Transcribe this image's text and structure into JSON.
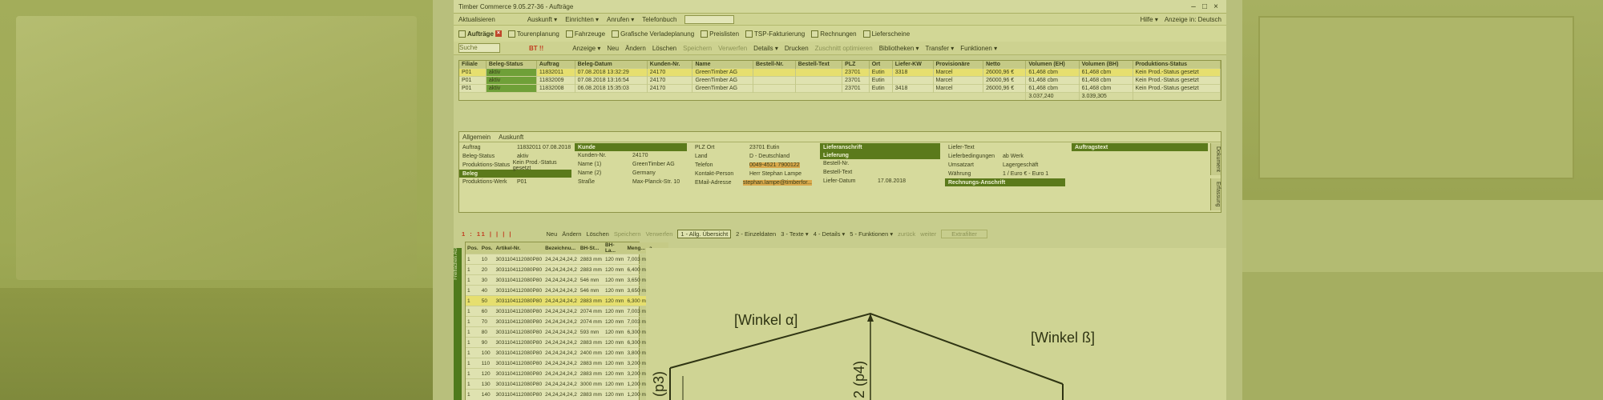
{
  "window": {
    "title": "Timber Commerce 9.05.27-36 - Aufträge",
    "close_label": "×",
    "max_label": "□",
    "min_label": "–"
  },
  "menubar": {
    "items": [
      "Aktualisieren",
      "Auskunft ▾",
      "Einrichten ▾",
      "Anrufen ▾",
      "Telefonbuch"
    ],
    "help": "Hilfe ▾",
    "display_lang": "Anzeige in: Deutsch"
  },
  "tabs": [
    {
      "label": "Aufträge",
      "active": true
    },
    {
      "label": "Tourenplanung"
    },
    {
      "label": "Fahrzeuge"
    },
    {
      "label": "Grafische Verladeplanung"
    },
    {
      "label": "Preislisten"
    },
    {
      "label": "TSP-Fakturierung"
    },
    {
      "label": "Rechnungen"
    },
    {
      "label": "Lieferscheine"
    }
  ],
  "toolbar": {
    "search_placeholder": "Suche",
    "bt": "BT !!",
    "items": [
      {
        "label": "Anzeige ▾",
        "dim": false
      },
      {
        "label": "Neu",
        "dim": false
      },
      {
        "label": "Ändern",
        "dim": false
      },
      {
        "label": "Löschen",
        "dim": false
      },
      {
        "label": "Speichern",
        "dim": true
      },
      {
        "label": "Verwerfen",
        "dim": true
      },
      {
        "label": "Details ▾",
        "dim": false
      },
      {
        "label": "Drucken",
        "dim": false
      },
      {
        "label": "Zuschnitt optimieren",
        "dim": true
      },
      {
        "label": "Bibliotheken ▾",
        "dim": false
      },
      {
        "label": "Transfer ▾",
        "dim": false
      },
      {
        "label": "Funktionen ▾",
        "dim": false
      }
    ]
  },
  "orders": {
    "columns": [
      "Filiale",
      "Beleg-Status",
      "Auftrag",
      "Beleg-Datum",
      "Kunden-Nr.",
      "Name",
      "Bestell-Nr.",
      "Bestell-Text",
      "PLZ",
      "Ort",
      "Liefer-KW",
      "Provisionäre",
      "Netto",
      "Volumen (EH)",
      "Volumen (BH)",
      "Produktions-Status"
    ],
    "rows": [
      [
        "P01",
        "aktiv",
        "11832011",
        "07.08.2018 13:32:29",
        "24170",
        "GreenTimber AG",
        "",
        "",
        "23701",
        "Eutin",
        "3318",
        "Marcel",
        "26000,96 €",
        "61,468 cbm",
        "61,468 cbm",
        "Kein Prod.-Status gesetzt"
      ],
      [
        "P01",
        "aktiv",
        "11832009",
        "07.08.2018 13:16:54",
        "24170",
        "GreenTimber AG",
        "",
        "",
        "23701",
        "Eutin",
        "",
        "Marcel",
        "26000,96 €",
        "61,468 cbm",
        "61,468 cbm",
        "Kein Prod.-Status gesetzt"
      ],
      [
        "P01",
        "aktiv",
        "11832008",
        "06.08.2018 15:35:03",
        "24170",
        "GreenTimber AG",
        "",
        "",
        "23701",
        "Eutin",
        "3418",
        "Marcel",
        "26000,96 €",
        "61,468 cbm",
        "61,468 cbm",
        "Kein Prod.-Status gesetzt"
      ]
    ],
    "sum_netto": "3.037,240",
    "sum_vol": "3.039,305"
  },
  "detail": {
    "tabs": [
      "Allgemein",
      "Auskunft"
    ],
    "col1": [
      {
        "label": "Auftrag",
        "value": "11832011   07.08.2018"
      },
      {
        "label": "Beleg-Status",
        "value": "aktiv"
      },
      {
        "label": "Produktions-Status",
        "value": "Kein Prod.-Status gesetzt"
      }
    ],
    "beleg_header": "Beleg",
    "col1b": [
      {
        "label": "Produktions-Werk",
        "value": "P01"
      }
    ],
    "kunde_header": "Kunde",
    "kunde": [
      {
        "label": "Kunden-Nr.",
        "value": "24170"
      },
      {
        "label": "Name (1)",
        "value": "GreenTimber AG"
      },
      {
        "label": "Name (2)",
        "value": "Germany"
      },
      {
        "label": "Straße",
        "value": "Max-Planck-Str. 10"
      }
    ],
    "addr": [
      {
        "label": "PLZ     Ort",
        "value": "23701   Eutin"
      },
      {
        "label": "Land",
        "value": "D - Deutschland"
      },
      {
        "label": "Telefon",
        "value": "0049-4521 7900122"
      },
      {
        "label": "Kontakt-Person",
        "value": "Herr Stephan Lampe"
      },
      {
        "label": "EMail-Adresse",
        "value": "stephan.lampe@timberfor..."
      }
    ],
    "lieferanschrift": "Lieferanschrift",
    "lieferung_header": "Lieferung",
    "lieferung": [
      {
        "label": "Bestell-Nr.",
        "value": ""
      },
      {
        "label": "Bestell-Text",
        "value": ""
      },
      {
        "label": "Liefer-Datum",
        "value": "17.08.2018"
      }
    ],
    "liefer": [
      {
        "label": "Liefer-Text",
        "value": ""
      },
      {
        "label": "Lieferbedingungen",
        "value": "ab Werk"
      },
      {
        "label": "Umsatzart",
        "value": "Lagergeschäft"
      },
      {
        "label": "Währung",
        "value": "1 / Euro     € - Euro     1"
      }
    ],
    "rechnungsanschrift": "Rechnungs-Anschrift",
    "auftragstext": "Auftragstext",
    "side_tab_1": "Dokument",
    "side_tab_2": "Erfassung"
  },
  "pos_toolbar": {
    "marks": "1 : 11  | | | |",
    "items": [
      {
        "label": "Neu",
        "dim": false
      },
      {
        "label": "Ändern",
        "dim": false
      },
      {
        "label": "Löschen",
        "dim": false
      },
      {
        "label": "Speichern",
        "dim": true
      },
      {
        "label": "Verwerfen",
        "dim": true
      }
    ],
    "tabs": [
      "1 - Allg. Übersicht",
      "2 - Einzeldaten",
      "3 - Texte ▾",
      "4 - Details ▾",
      "5 - Funktionen ▾",
      "zurück",
      "weiter"
    ],
    "filter": "Extrafilter"
  },
  "positions": {
    "columns": [
      "Pos.",
      "Pos.",
      "Artikel-Nr.",
      "Bezeichnu...",
      "BH-St...",
      "BH-La...",
      "Meng...",
      "a"
    ],
    "rows": [
      [
        "1",
        "10",
        "3031104112080P80",
        "24,24,24,24,2",
        "2883 mm",
        "120 mm",
        "7,003 m",
        "1 Stück"
      ],
      [
        "1",
        "20",
        "3031104112080P80",
        "24,24,24,24,2",
        "2883 mm",
        "120 mm",
        "6,400 m",
        "1 Stück"
      ],
      [
        "1",
        "30",
        "3031104112080P80",
        "24,24,24,24,2",
        "546 mm",
        "120 mm",
        "3,650 m",
        "1 Stück"
      ],
      [
        "1",
        "40",
        "3031104112080P80",
        "24,24,24,24,2",
        "546 mm",
        "120 mm",
        "3,650 m",
        "1 Stück"
      ],
      [
        "1",
        "50",
        "3031104112080P80",
        "24,24,24,24,2",
        "2883 mm",
        "120 mm",
        "6,300 m",
        "1 Stück"
      ],
      [
        "1",
        "60",
        "3031104112080P80",
        "24,24,24,24,2",
        "2074 mm",
        "120 mm",
        "7,003 m",
        "1 Stück"
      ],
      [
        "1",
        "70",
        "3031104112080P80",
        "24,24,24,24,2",
        "2074 mm",
        "120 mm",
        "7,003 m",
        "1 Stück"
      ],
      [
        "1",
        "80",
        "3031104112080P80",
        "24,24,24,24,2",
        "593 mm",
        "120 mm",
        "6,300 m",
        "1 Stück"
      ],
      [
        "1",
        "90",
        "3031104112080P80",
        "24,24,24,24,2",
        "2883 mm",
        "120 mm",
        "6,300 m",
        "1 Stück"
      ],
      [
        "1",
        "100",
        "3031104112080P80",
        "24,24,24,24,2",
        "2400 mm",
        "120 mm",
        "3,800 m",
        "1 Stück"
      ],
      [
        "1",
        "110",
        "3031104112080P80",
        "24,24,24,24,2",
        "2883 mm",
        "120 mm",
        "3,200 m",
        "1 Stück"
      ],
      [
        "1",
        "120",
        "3031104112080P80",
        "24,24,24,24,2",
        "2883 mm",
        "120 mm",
        "3,200 m",
        "1 Stück"
      ],
      [
        "1",
        "130",
        "3031104112080P80",
        "24,24,24,24,2",
        "3000 mm",
        "120 mm",
        "1,200 m",
        "1 Stück"
      ],
      [
        "1",
        "140",
        "3031104112080P80",
        "24,24,24,24,2",
        "2883 mm",
        "120 mm",
        "1,200 m",
        "1 Stück"
      ]
    ],
    "side_label": "Freiflächen AG"
  },
  "drawing": {
    "label_winkel_a": "[Winkel α]",
    "label_winkel_b": "[Winkel ß]",
    "label_p3": "(p3)",
    "label_p4": "2 (p4)"
  }
}
